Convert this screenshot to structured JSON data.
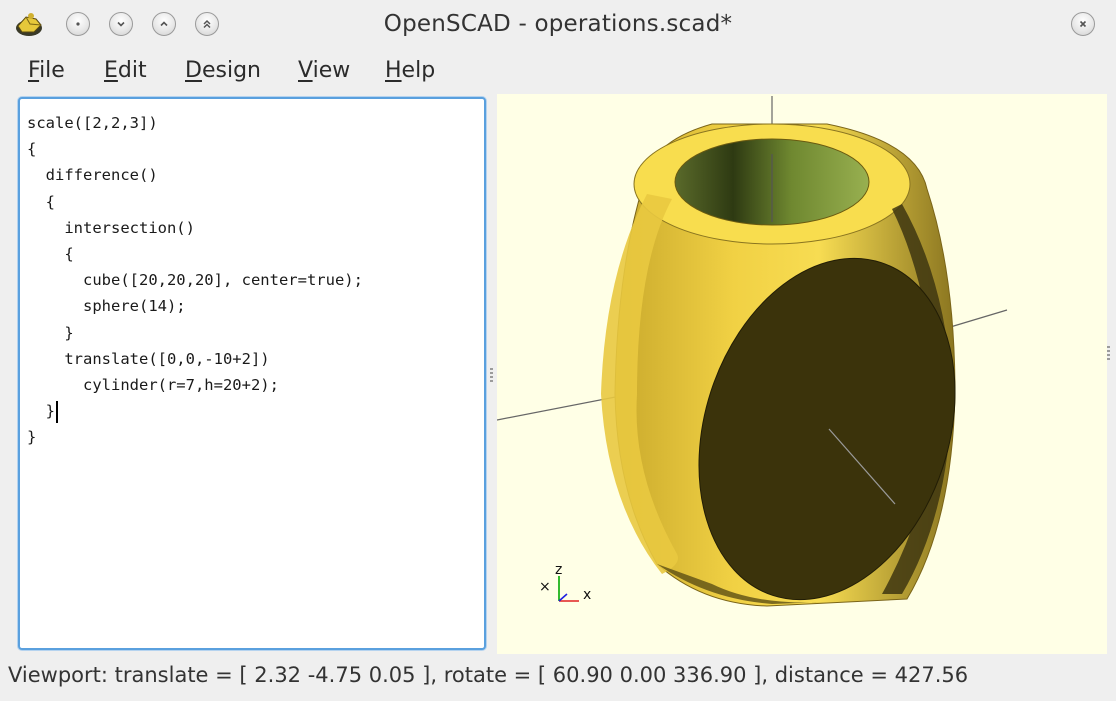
{
  "window": {
    "title": "OpenSCAD - operations.scad*",
    "buttons": [
      "app-menu-icon",
      "minimize-icon",
      "shade-icon",
      "maximize-icon",
      "keep-above-icon",
      "close-icon"
    ]
  },
  "menu": [
    {
      "mnemonic": "F",
      "rest": "ile"
    },
    {
      "mnemonic": "E",
      "rest": "dit"
    },
    {
      "mnemonic": "D",
      "rest": "esign"
    },
    {
      "mnemonic": "V",
      "rest": "iew"
    },
    {
      "mnemonic": "H",
      "rest": "elp"
    }
  ],
  "editor": {
    "lines": [
      "scale([2,2,3])",
      "{",
      "  difference()",
      "  {",
      "    intersection()",
      "    {",
      "      cube([20,20,20], center=true);",
      "      sphere(14);",
      "    }",
      "    translate([0,0,-10+2])",
      "      cylinder(r=7,h=20+2);",
      "  }",
      "}"
    ],
    "caret_line": 11
  },
  "viewport": {
    "background": "#ffffe6",
    "model_color": "#f5d54a",
    "axis_labels": {
      "x": "x",
      "z": "z"
    }
  },
  "status": {
    "text": "Viewport: translate = [ 2.32 -4.75 0.05 ], rotate = [ 60.90 0.00 336.90 ], distance = 427.56"
  }
}
